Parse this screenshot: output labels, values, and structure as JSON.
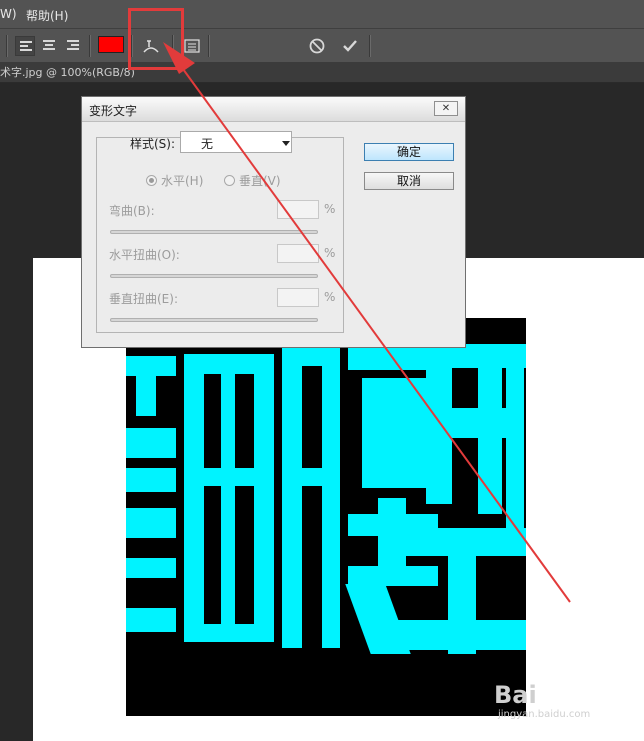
{
  "menubar": {
    "item1": "W)",
    "item2": "帮助(H)"
  },
  "doc_tab": {
    "title": "术字.jpg @ 100%(RGB/8)"
  },
  "dialog": {
    "title": "变形文字",
    "close_label": "✕",
    "style_label": "样式(S):",
    "style_value": "无",
    "radio_horizontal": "水平(H)",
    "radio_vertical": "垂直(V)",
    "bend_label": "弯曲(B):",
    "h_distort_label": "水平扭曲(O):",
    "v_distort_label": "垂直扭曲(E):",
    "unit": "%",
    "ok_label": "确定",
    "cancel_label": "取消"
  },
  "watermark": {
    "brand": "Bai",
    "sub": "jingyan.baidu.com"
  },
  "colors": {
    "text_color": "#ff0000",
    "art_text": "#00f3ff",
    "annotation": "#e23b3b"
  },
  "icons": [
    "align-left-icon",
    "align-center-icon",
    "align-right-icon",
    "warp-text-icon",
    "character-panel-icon",
    "cancel-icon",
    "commit-icon"
  ]
}
